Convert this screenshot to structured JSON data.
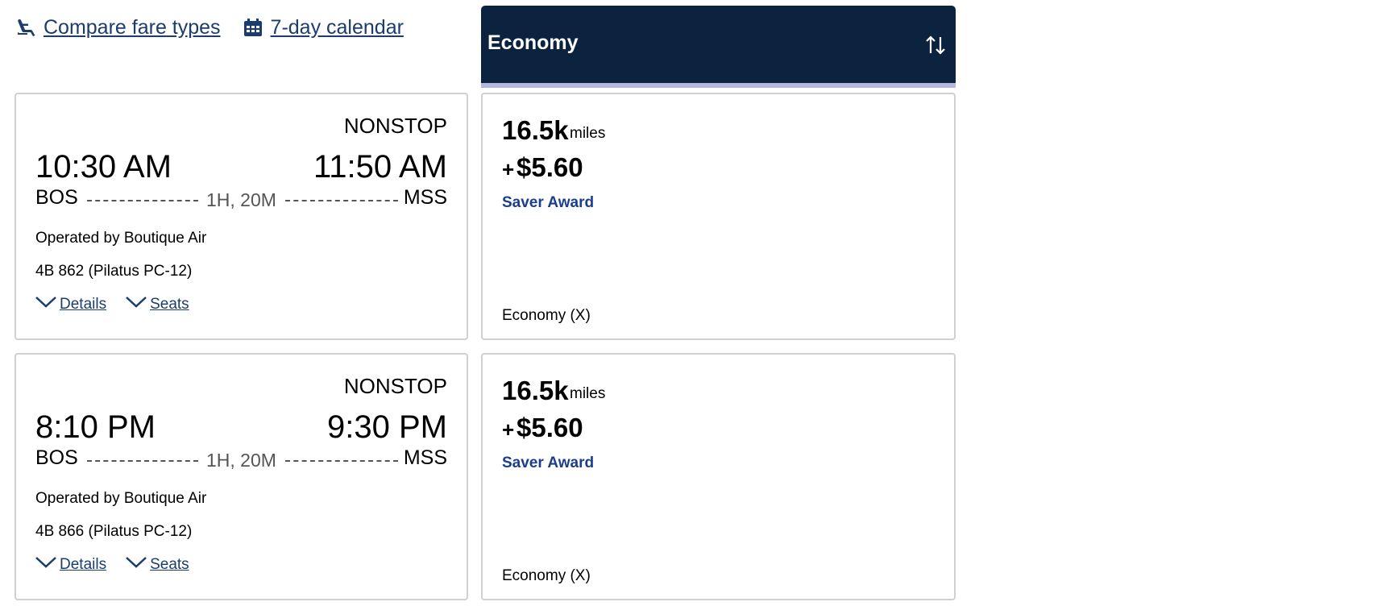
{
  "links": {
    "compare": "Compare fare types",
    "calendar": "7-day calendar"
  },
  "cabin": {
    "title": "Economy"
  },
  "flights": [
    {
      "tag": "NONSTOP",
      "dep_time": "10:30 AM",
      "arr_time": "11:50 AM",
      "dep_code": "BOS",
      "arr_code": "MSS",
      "duration": "1H, 20M",
      "operated_by": "Operated by Boutique Air",
      "flight_number": "4B 862 (Pilatus PC-12)",
      "details_label": "Details",
      "seats_label": "Seats",
      "fare": {
        "miles": "16.5k",
        "miles_unit": "miles",
        "plus": "+",
        "fee": "$5.60",
        "award": "Saver Award",
        "fare_class": "Economy (X)"
      }
    },
    {
      "tag": "NONSTOP",
      "dep_time": "8:10 PM",
      "arr_time": "9:30 PM",
      "dep_code": "BOS",
      "arr_code": "MSS",
      "duration": "1H, 20M",
      "operated_by": "Operated by Boutique Air",
      "flight_number": "4B 866 (Pilatus PC-12)",
      "details_label": "Details",
      "seats_label": "Seats",
      "fare": {
        "miles": "16.5k",
        "miles_unit": "miles",
        "plus": "+",
        "fee": "$5.60",
        "award": "Saver Award",
        "fare_class": "Economy (X)"
      }
    }
  ],
  "icons": {
    "compare": "seat-icon",
    "calendar": "calendar-icon",
    "sort": "sort-arrows-icon",
    "details": "chevron-down-icon",
    "seats": "chevron-down-icon"
  },
  "colors": {
    "header_bg": "#0c2340",
    "header_band": "#b3b8e0",
    "link": "#1b3c6e",
    "award": "#1a3d8f"
  }
}
